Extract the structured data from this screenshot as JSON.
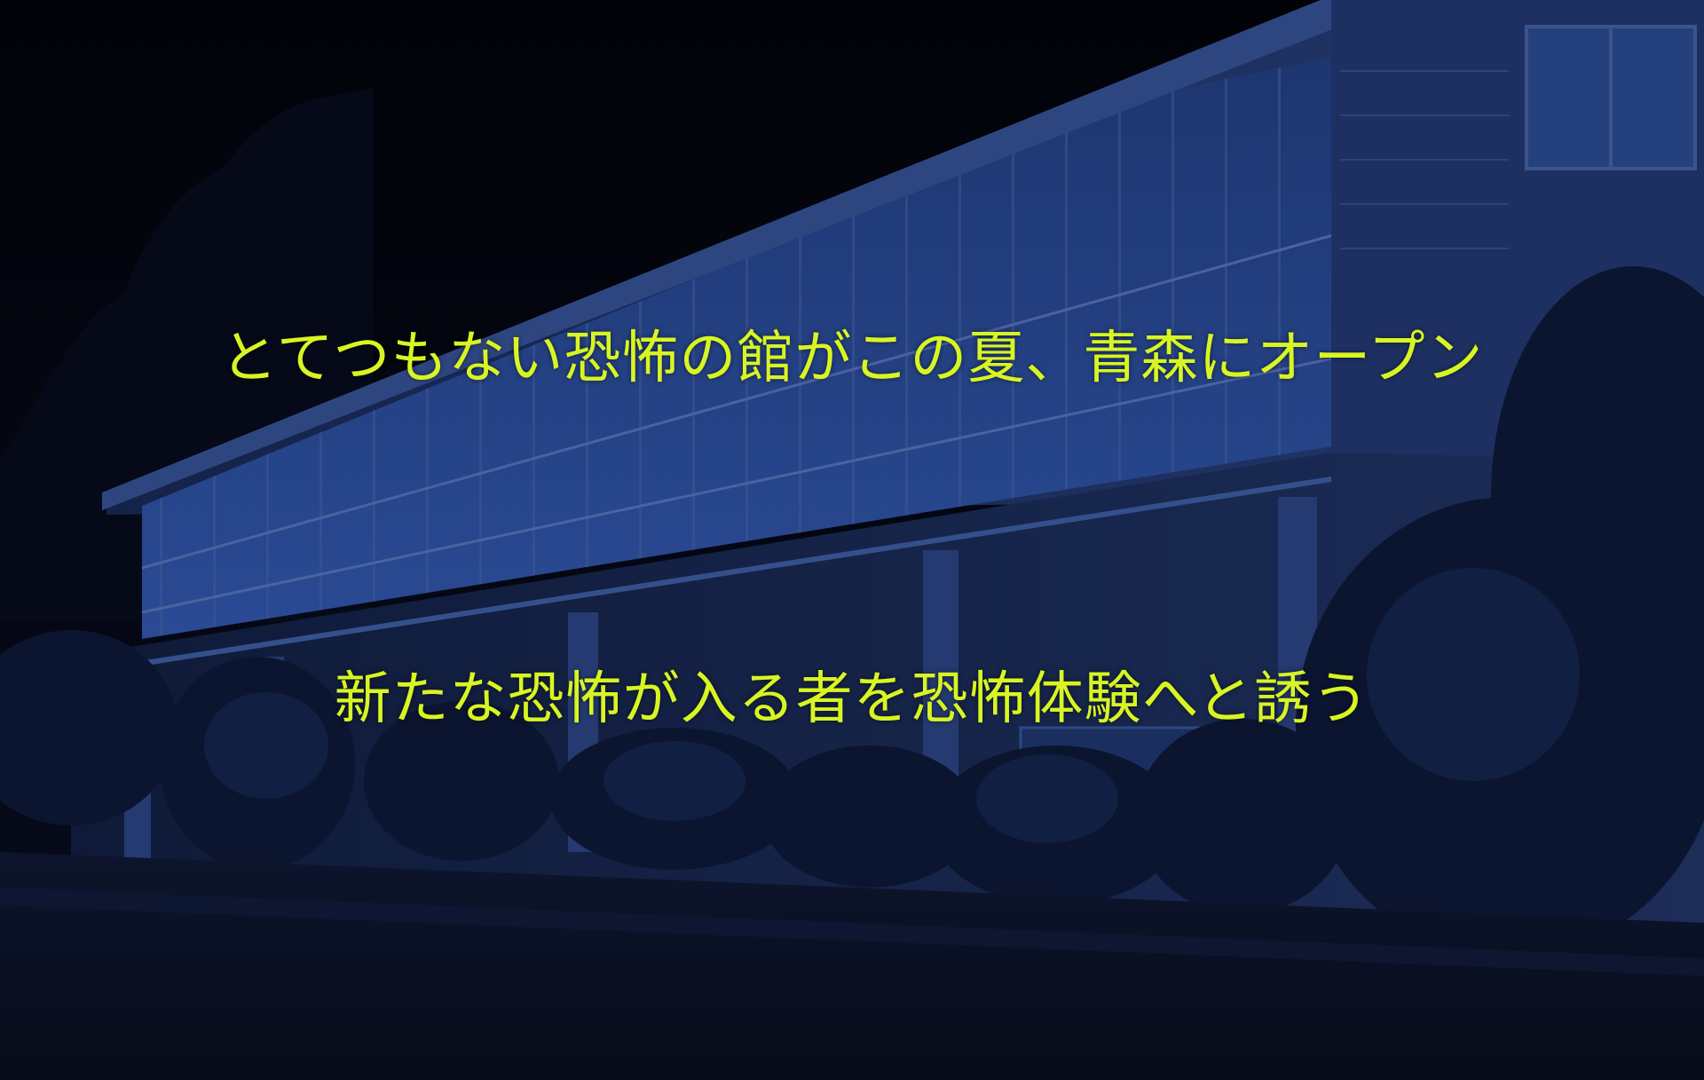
{
  "captions": {
    "headline": "とてつもない恐怖の館がこの夏、青森にオープン",
    "tagline": "新たな恐怖が入る者を恐怖体験へと誘う"
  },
  "scene": {
    "subject": "school-building-at-night",
    "colors": {
      "sky": "#04060f",
      "building": "#1b2c52",
      "windows": "#23407e",
      "foliage": "#0a1428",
      "ground": "#0c1327",
      "caption": "#d8f523"
    }
  }
}
